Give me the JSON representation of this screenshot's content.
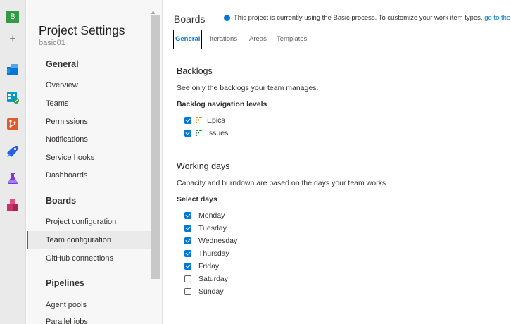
{
  "rail": {
    "org_initial": "B",
    "plus": "+",
    "services": [
      {
        "name": "overview-icon",
        "color": "#0078d4"
      },
      {
        "name": "boards-icon",
        "color": "#009ccc"
      },
      {
        "name": "repos-icon",
        "color": "#e05b2b"
      },
      {
        "name": "pipelines-icon",
        "color": "#2560e0"
      },
      {
        "name": "test-plans-icon",
        "color": "#773adc"
      },
      {
        "name": "artifacts-icon",
        "color": "#cb2e6d"
      }
    ]
  },
  "nav": {
    "title": "Project Settings",
    "subtitle": "basic01",
    "groups": {
      "general": "General",
      "boards": "Boards",
      "pipelines": "Pipelines"
    },
    "items": {
      "overview": "Overview",
      "teams": "Teams",
      "permissions": "Permissions",
      "notifications": "Notifications",
      "service_hooks": "Service hooks",
      "dashboards": "Dashboards",
      "project_configuration": "Project configuration",
      "team_configuration": "Team configuration",
      "github_connections": "GitHub connections",
      "agent_pools": "Agent pools",
      "parallel_jobs": "Parallel jobs"
    },
    "selected": "Team configuration"
  },
  "main": {
    "header_title": "Boards",
    "banner_text": "This project is currently using the Basic process. To customize your work item types, ",
    "banner_link": "go to the",
    "tabs": [
      "General",
      "Iterations",
      "Areas",
      "Templates"
    ],
    "active_tab": "General",
    "backlogs": {
      "title": "Backlogs",
      "description": "See only the backlogs your team manages.",
      "levels_label": "Backlog navigation levels",
      "levels": [
        {
          "label": "Epics",
          "checked": true,
          "icon": "epic-icon",
          "color": "#ff7b00"
        },
        {
          "label": "Issues",
          "checked": true,
          "icon": "issue-icon",
          "color": "#339947"
        }
      ]
    },
    "working_days": {
      "title": "Working days",
      "description": "Capacity and burndown are based on the days your team works.",
      "select_label": "Select days",
      "days": [
        {
          "label": "Monday",
          "checked": true
        },
        {
          "label": "Tuesday",
          "checked": true
        },
        {
          "label": "Wednesday",
          "checked": true
        },
        {
          "label": "Thursday",
          "checked": true
        },
        {
          "label": "Friday",
          "checked": true
        },
        {
          "label": "Saturday",
          "checked": false
        },
        {
          "label": "Sunday",
          "checked": false
        }
      ]
    }
  }
}
